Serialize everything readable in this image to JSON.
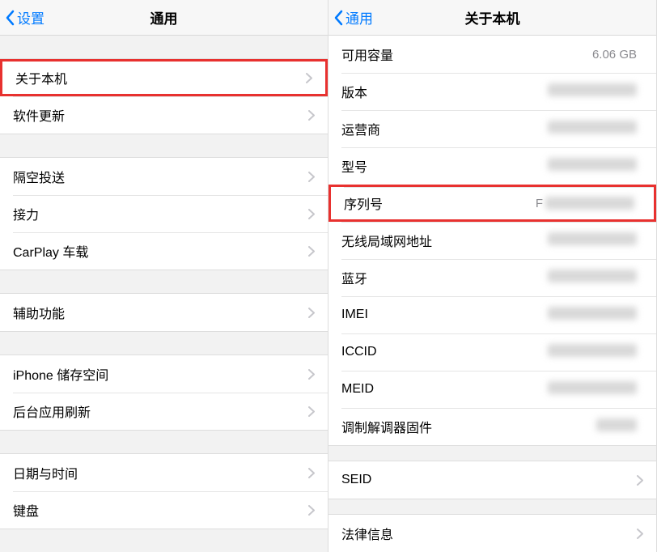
{
  "left": {
    "back_label": "设置",
    "title": "通用",
    "groups": [
      [
        {
          "label": "关于本机",
          "highlight": true
        },
        {
          "label": "软件更新"
        }
      ],
      [
        {
          "label": "隔空投送"
        },
        {
          "label": "接力"
        },
        {
          "label": "CarPlay 车载"
        }
      ],
      [
        {
          "label": "辅助功能"
        }
      ],
      [
        {
          "label": "iPhone 储存空间"
        },
        {
          "label": "后台应用刷新"
        }
      ],
      [
        {
          "label": "日期与时间"
        },
        {
          "label": "键盘"
        }
      ]
    ]
  },
  "right": {
    "back_label": "通用",
    "title": "关于本机",
    "rows_top": [
      {
        "label": "可用容量",
        "value": "6.06 GB",
        "blur": false
      },
      {
        "label": "版本",
        "blur": true
      },
      {
        "label": "运营商",
        "blur": true
      },
      {
        "label": "型号",
        "blur": true
      },
      {
        "label": "序列号",
        "value_prefix": "F",
        "blur": true,
        "highlight": true
      },
      {
        "label": "无线局域网地址",
        "blur": true
      },
      {
        "label": "蓝牙",
        "blur": true
      },
      {
        "label": "IMEI",
        "blur": true
      },
      {
        "label": "ICCID",
        "blur": true
      },
      {
        "label": "MEID",
        "blur": true
      },
      {
        "label": "调制解调器固件",
        "blur": true
      }
    ],
    "rows_mid": [
      {
        "label": "SEID",
        "chevron": true
      }
    ],
    "rows_bottom": [
      {
        "label": "法律信息",
        "chevron": true
      }
    ]
  }
}
